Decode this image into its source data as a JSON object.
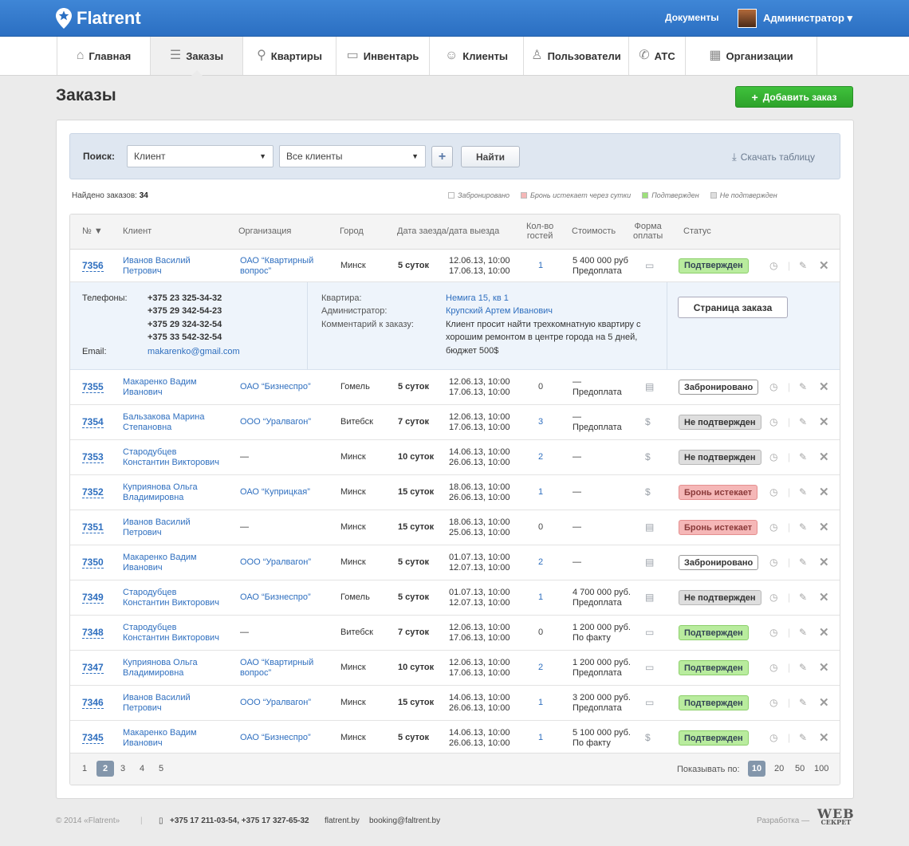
{
  "app": {
    "name": "Flatrent",
    "docs": "Документы",
    "user": "Администратор ▾"
  },
  "nav": [
    {
      "label": "Главная",
      "icon": "⌂"
    },
    {
      "label": "Заказы",
      "icon": "☰"
    },
    {
      "label": "Квартиры",
      "icon": "⚲"
    },
    {
      "label": "Инвентарь",
      "icon": "▭"
    },
    {
      "label": "Клиенты",
      "icon": "☺"
    },
    {
      "label": "Пользователи",
      "icon": "♙"
    },
    {
      "label": "АТС",
      "icon": "✆"
    },
    {
      "label": "Организации",
      "icon": "▦"
    }
  ],
  "page": {
    "title": "Заказы",
    "add_button": "Добавить заказ"
  },
  "search": {
    "label": "Поиск:",
    "field1": "Клиент",
    "field2": "Все клиенты",
    "plus": "+",
    "find": "Найти",
    "download": "Скачать таблицу"
  },
  "found": {
    "label": "Найдено заказов:",
    "count": "34"
  },
  "legend": [
    {
      "label": "Забронировано",
      "color": "#ffffff"
    },
    {
      "label": "Бронь истекает через сутки",
      "color": "#f5b7b7"
    },
    {
      "label": "Подтвержден",
      "color": "#9de07a"
    },
    {
      "label": "Не подтвержден",
      "color": "#dedede"
    }
  ],
  "headers": {
    "num": "№ ▼",
    "client": "Клиент",
    "org": "Организация",
    "city": "Город",
    "dates": "Дата заезда/дата выезда",
    "guests1": "Кол-во",
    "guests2": "гостей",
    "cost": "Стоимость",
    "pay1": "Форма",
    "pay2": "оплаты",
    "status": "Статус"
  },
  "rows": [
    {
      "num": "7356",
      "client1": "Иванов Василий",
      "client2": "Петрович",
      "org1": "ОАО “Квартирный",
      "org2": "вопрос”",
      "city": "Минск",
      "nights": "5 суток",
      "d1": "12.06.13, 10:00",
      "d2": "17.06.13, 10:00",
      "guests": "1",
      "c1": "5 400 000 руб",
      "c2": "Предоплата",
      "pay": "▭",
      "status": "Подтвержден",
      "st": "ok"
    },
    {
      "num": "7355",
      "client1": "Макаренко Вадим",
      "client2": "Иванович",
      "org1": "ОАО “Бизнеспро”",
      "org2": "",
      "city": "Гомель",
      "nights": "5 суток",
      "d1": "12.06.13, 10:00",
      "d2": "17.06.13, 10:00",
      "guests": "0",
      "c1": "—",
      "c2": "Предоплата",
      "pay": "▤",
      "status": "Забронировано",
      "st": "res"
    },
    {
      "num": "7354",
      "client1": "Бальзакова Марина",
      "client2": "Степановна",
      "org1": "ООО “Уралвагон”",
      "org2": "",
      "city": "Витебск",
      "nights": "7 суток",
      "d1": "12.06.13, 10:00",
      "d2": "17.06.13, 10:00",
      "guests": "3",
      "c1": "—",
      "c2": "Предоплата",
      "pay": "$",
      "status": "Не подтвержден",
      "st": "no"
    },
    {
      "num": "7353",
      "client1": "Стародубцев",
      "client2": "Константин Викторович",
      "org1": "—",
      "org2": "",
      "city": "Минск",
      "nights": "10 суток",
      "d1": "14.06.13, 10:00",
      "d2": "26.06.13, 10:00",
      "guests": "2",
      "c1": "—",
      "c2": "",
      "pay": "$",
      "status": "Не подтвержден",
      "st": "no"
    },
    {
      "num": "7352",
      "client1": "Куприянова Ольга",
      "client2": "Владимировна",
      "org1": "ОАО “Куприцкая”",
      "org2": "",
      "city": "Минск",
      "nights": "15 суток",
      "d1": "18.06.13, 10:00",
      "d2": "26.06.13, 10:00",
      "guests": "1",
      "c1": "—",
      "c2": "",
      "pay": "$",
      "status": "Бронь истекает",
      "st": "exp"
    },
    {
      "num": "7351",
      "client1": "Иванов Василий",
      "client2": "Петрович",
      "org1": "—",
      "org2": "",
      "city": "Минск",
      "nights": "15 суток",
      "d1": "18.06.13, 10:00",
      "d2": "25.06.13, 10:00",
      "guests": "0",
      "c1": "—",
      "c2": "",
      "pay": "▤",
      "status": "Бронь истекает",
      "st": "exp"
    },
    {
      "num": "7350",
      "client1": "Макаренко Вадим",
      "client2": "Иванович",
      "org1": "ООО “Уралвагон”",
      "org2": "",
      "city": "Минск",
      "nights": "5 суток",
      "d1": "01.07.13, 10:00",
      "d2": "12.07.13, 10:00",
      "guests": "2",
      "c1": "—",
      "c2": "",
      "pay": "▤",
      "status": "Забронировано",
      "st": "res"
    },
    {
      "num": "7349",
      "client1": "Стародубцев",
      "client2": "Константин Викторович",
      "org1": "ОАО “Бизнеспро”",
      "org2": "",
      "city": "Гомель",
      "nights": "5 суток",
      "d1": "01.07.13, 10:00",
      "d2": "12.07.13, 10:00",
      "guests": "1",
      "c1": "4 700 000 руб.",
      "c2": "Предоплата",
      "pay": "▤",
      "status": "Не подтвержден",
      "st": "no"
    },
    {
      "num": "7348",
      "client1": "Стародубцев",
      "client2": "Константин Викторович",
      "org1": "—",
      "org2": "",
      "city": "Витебск",
      "nights": "7 суток",
      "d1": "12.06.13, 10:00",
      "d2": "17.06.13, 10:00",
      "guests": "0",
      "c1": "1 200 000 руб.",
      "c2": "По факту",
      "pay": "▭",
      "status": "Подтвержден",
      "st": "ok"
    },
    {
      "num": "7347",
      "client1": "Куприянова Ольга",
      "client2": "Владимировна",
      "org1": "ОАО “Квартирный",
      "org2": "вопрос”",
      "city": "Минск",
      "nights": "10 суток",
      "d1": "12.06.13, 10:00",
      "d2": "17.06.13, 10:00",
      "guests": "2",
      "c1": "1 200 000 руб.",
      "c2": "Предоплата",
      "pay": "▭",
      "status": "Подтвержден",
      "st": "ok"
    },
    {
      "num": "7346",
      "client1": "Иванов Василий",
      "client2": "Петрович",
      "org1": "ООО “Уралвагон”",
      "org2": "",
      "city": "Минск",
      "nights": "15 суток",
      "d1": "14.06.13, 10:00",
      "d2": "26.06.13, 10:00",
      "guests": "1",
      "c1": "3 200 000 руб.",
      "c2": "Предоплата",
      "pay": "▭",
      "status": "Подтвержден",
      "st": "ok"
    },
    {
      "num": "7345",
      "client1": "Макаренко Вадим",
      "client2": "Иванович",
      "org1": "ОАО “Бизнеспро”",
      "org2": "",
      "city": "Минск",
      "nights": "5 суток",
      "d1": "14.06.13, 10:00",
      "d2": "26.06.13, 10:00",
      "guests": "1",
      "c1": "5 100 000 руб.",
      "c2": "По факту",
      "pay": "$",
      "status": "Подтвержден",
      "st": "ok"
    }
  ],
  "detail": {
    "phones_label": "Телефоны:",
    "phones": [
      "+375 23 325-34-32",
      "+375 29 342-54-23",
      "+375 29 324-32-54",
      "+375 33 542-32-54"
    ],
    "email_label": "Email:",
    "email": "makarenko@gmail.com",
    "flat_label": "Квартира:",
    "flat": "Немига 15, кв 1",
    "admin_label": "Администратор:",
    "admin": "Крупский Артем Иванович",
    "comment_label": "Комментарий к заказу:",
    "comment": [
      "Клиент просит найти трехкомнатную квартиру с",
      "хорошим ремонтом в центре города на 5 дней,",
      "бюджет 500$"
    ],
    "button": "Страница заказа"
  },
  "pager": {
    "pages": [
      "1",
      "2",
      "3",
      "4",
      "5"
    ],
    "active_page": "2",
    "show_label": "Показывать по:",
    "sizes": [
      "10",
      "20",
      "50",
      "100"
    ],
    "active_size": "10"
  },
  "footer": {
    "copyright": "© 2014 «Flatrent»",
    "phones": "+375 17 211-03-54, +375 17 327-65-32",
    "site": "flatrent.by",
    "email": "booking@faltrent.by",
    "dev": "Разработка —",
    "dev_logo_1": "WEB",
    "dev_logo_2": "СЕКРЕТ"
  }
}
